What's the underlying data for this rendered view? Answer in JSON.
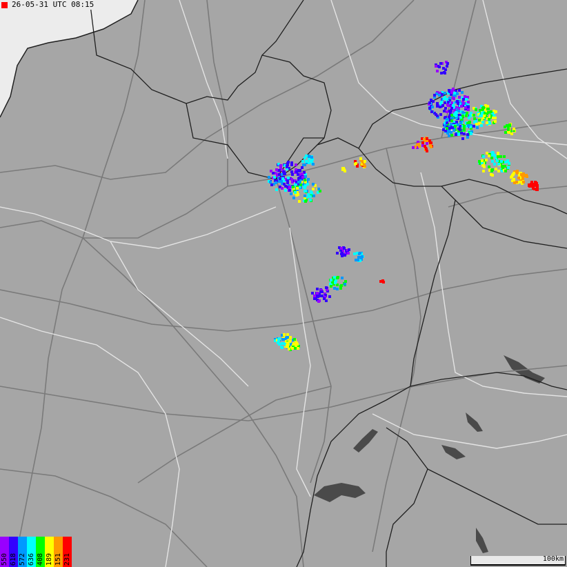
{
  "timestamp": "26-05-31 UTC 08:15",
  "scale_label": "100km",
  "legend": [
    {
      "label": "550",
      "color": "#9900ff"
    },
    {
      "label": "618",
      "color": "#3300ff"
    },
    {
      "label": "572",
      "color": "#0099ff"
    },
    {
      "label": "636",
      "color": "#00ffff"
    },
    {
      "label": "408",
      "color": "#00ff00"
    },
    {
      "label": "189",
      "color": "#ffff00"
    },
    {
      "label": "151",
      "color": "#ff9900"
    },
    {
      "label": "231",
      "color": "#ff0000"
    }
  ],
  "colors": {
    "land": "#a6a6a6",
    "sea": "#ececec",
    "lake": "#4a4a4a",
    "border": "#1f1f1f",
    "road": "#7a7a7a",
    "river": "#e4e4e4"
  }
}
